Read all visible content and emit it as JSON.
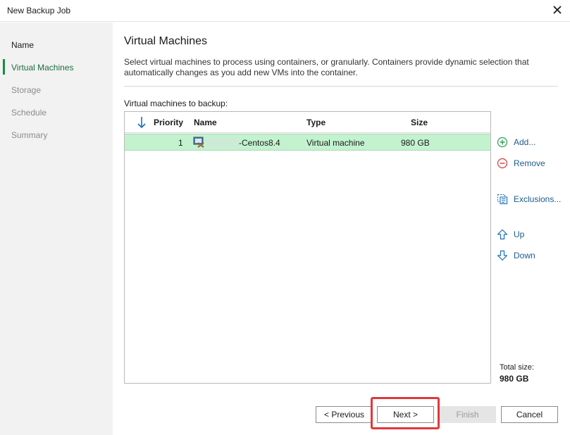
{
  "window": {
    "title": "New Backup Job"
  },
  "colors": {
    "accent": "#1c8c3d",
    "row_selected": "#c3f2cf",
    "link": "#1c5c8c",
    "highlight": "#e0393b"
  },
  "sidebar": {
    "items": [
      {
        "label": "Name",
        "state": "normal"
      },
      {
        "label": "Virtual Machines",
        "state": "active"
      },
      {
        "label": "Storage",
        "state": "disabled"
      },
      {
        "label": "Schedule",
        "state": "disabled"
      },
      {
        "label": "Summary",
        "state": "disabled"
      }
    ]
  },
  "main": {
    "heading": "Virtual Machines",
    "description": "Select virtual machines to process using containers, or granularly. Containers provide dynamic selection that automatically changes as you add new VMs into the container.",
    "list_label": "Virtual machines to backup:",
    "columns": [
      "Priority",
      "Name",
      "Type",
      "Size"
    ],
    "rows": [
      {
        "priority": "1",
        "name": "-Centos8.4",
        "type": "Virtual machine",
        "size": "980 GB"
      }
    ],
    "actions": [
      {
        "label": "Add...",
        "icon": "plus-circle-icon"
      },
      {
        "label": "Remove",
        "icon": "minus-circle-icon"
      },
      {
        "label": "Exclusions...",
        "icon": "exclusions-icon"
      },
      {
        "label": "Up",
        "icon": "arrow-up-icon"
      },
      {
        "label": "Down",
        "icon": "arrow-down-icon"
      }
    ],
    "total_size_label": "Total size:",
    "total_size_value": "980 GB"
  },
  "footer": {
    "previous": "< Previous",
    "next": "Next >",
    "finish": "Finish",
    "cancel": "Cancel"
  }
}
